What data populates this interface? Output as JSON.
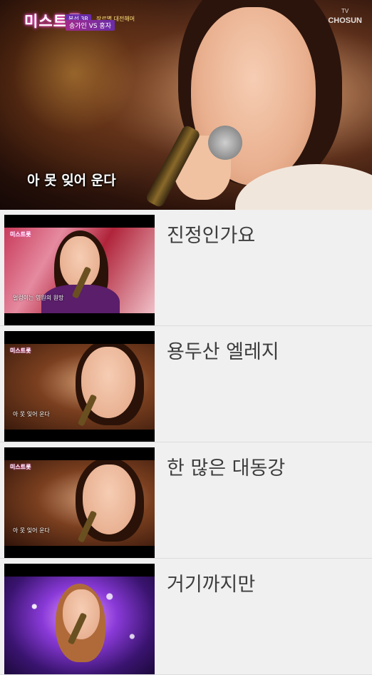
{
  "player": {
    "logo": "미스트롯",
    "episode_tag": "본선 3R",
    "episode_sub": "장르별 대전해머",
    "matchup": "송가인 VS 홍자",
    "channel_tv": "TV",
    "channel_name": "CHOSUN",
    "caption": "아 못 잊어 운다"
  },
  "list": [
    {
      "title": "진정인가요",
      "thumb_logo": "미스트롯",
      "thumb_caption": "얼렁이는 영원의 원망"
    },
    {
      "title": "용두산 엘레지",
      "thumb_logo": "미스트롯",
      "thumb_caption": "아 못 잊어 운다"
    },
    {
      "title": "한 많은 대동강",
      "thumb_logo": "미스트롯",
      "thumb_caption": "아 못 잊어 운다"
    },
    {
      "title": "거기까지만",
      "thumb_logo": "",
      "thumb_caption": ""
    }
  ]
}
